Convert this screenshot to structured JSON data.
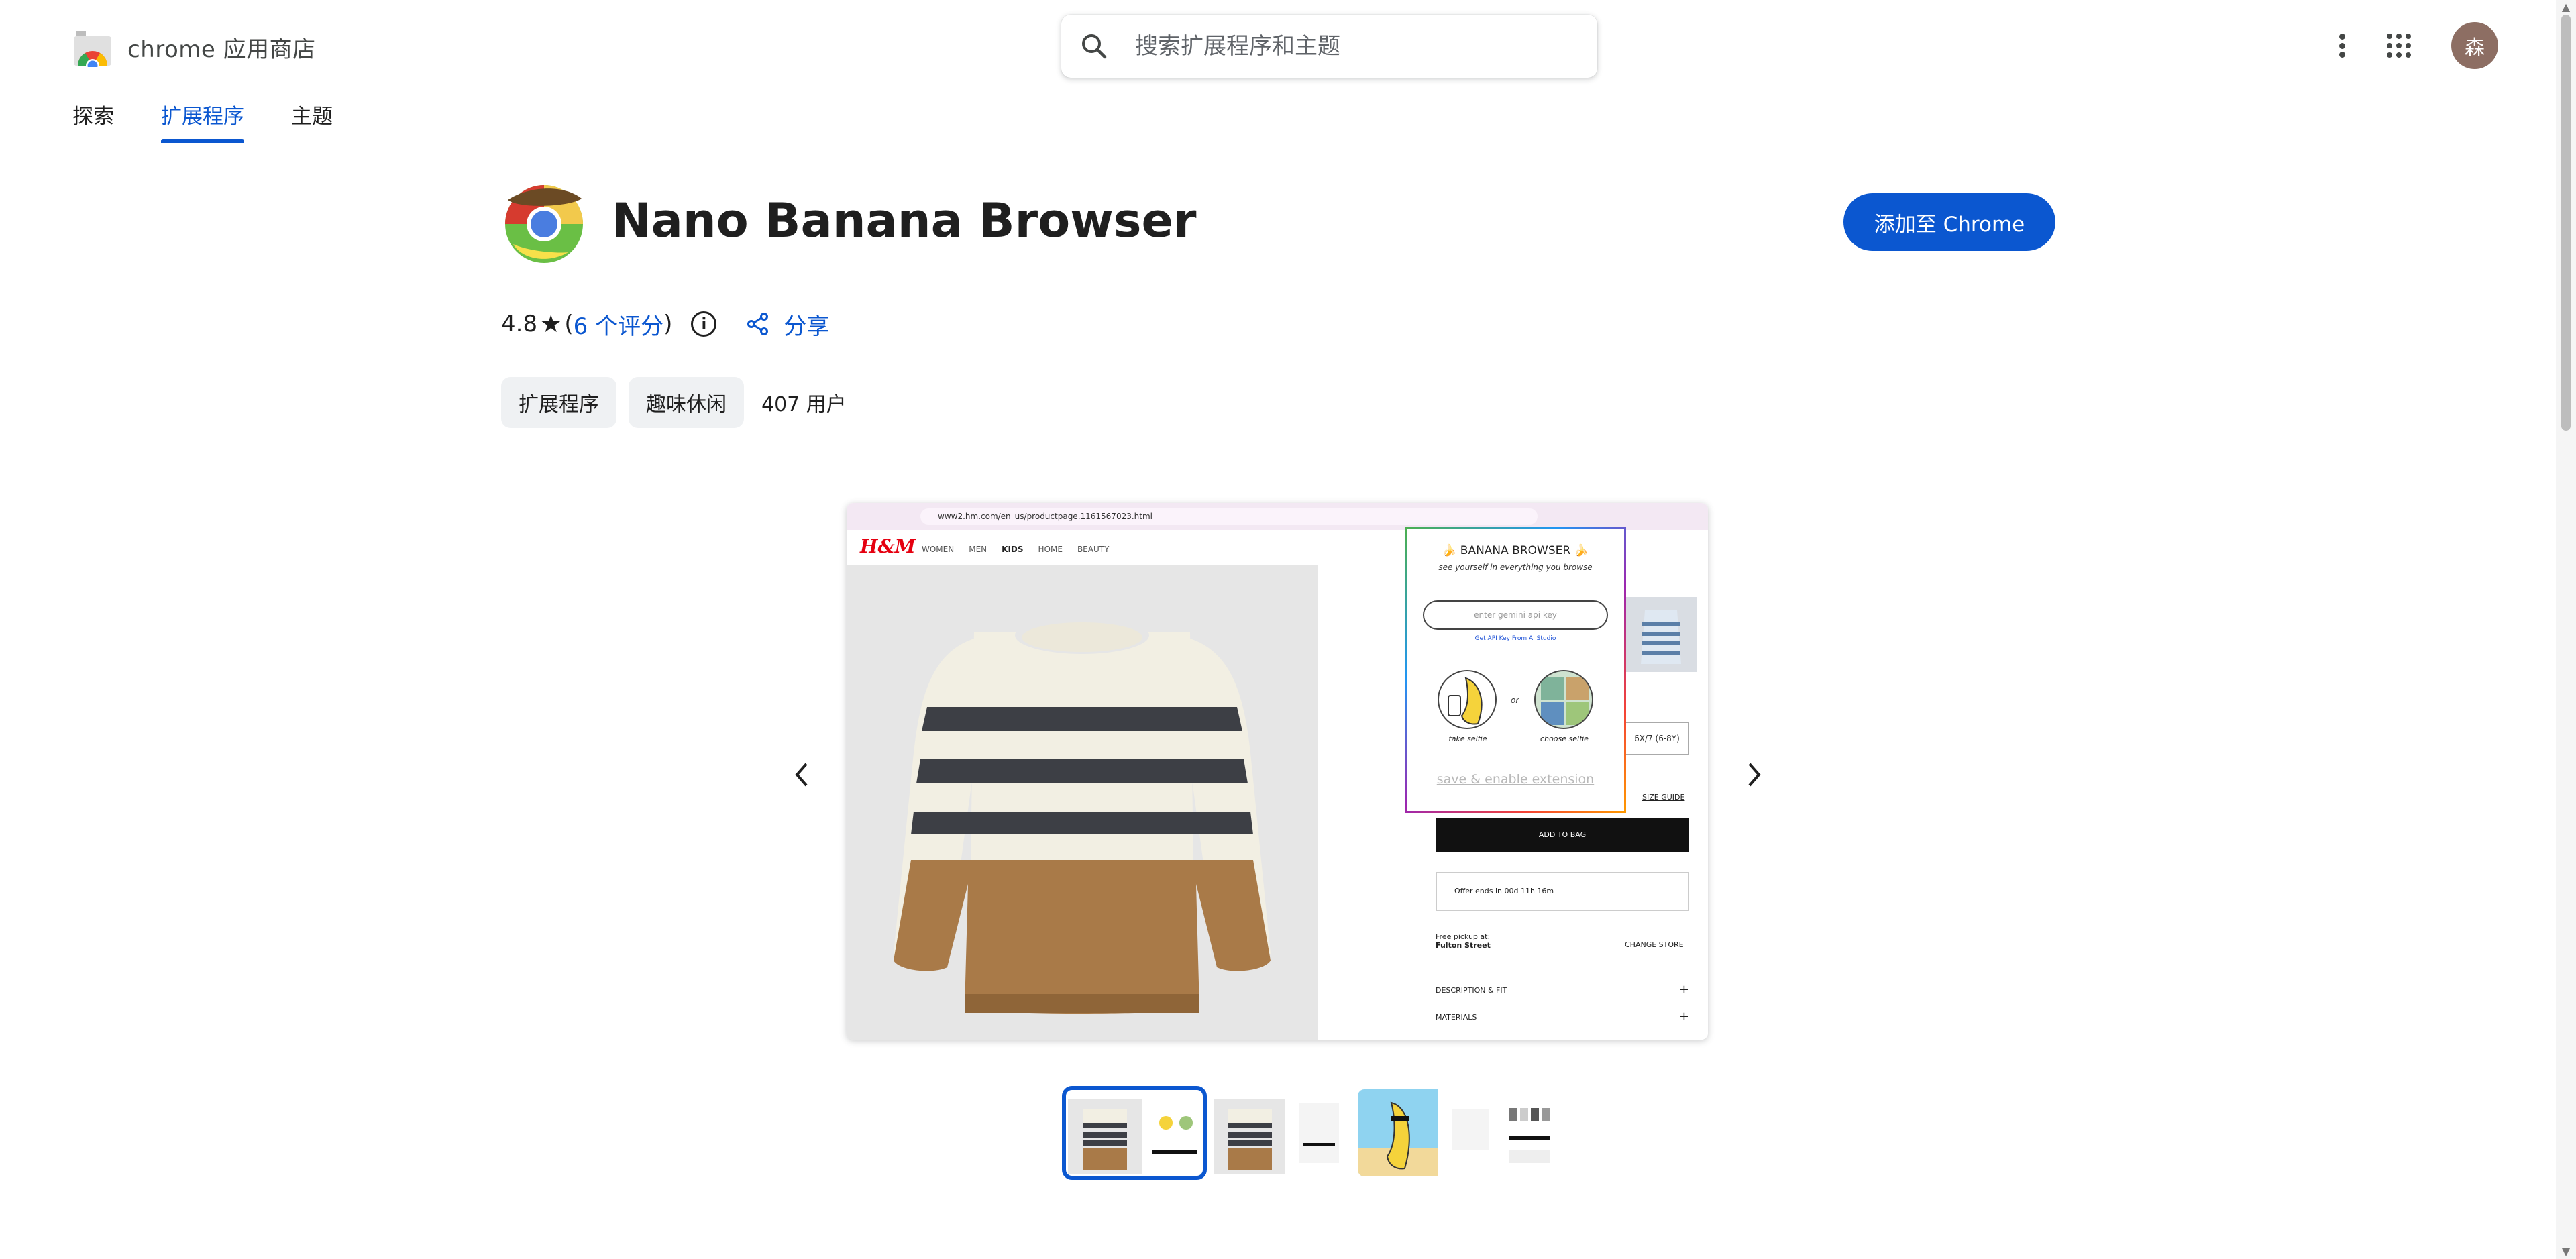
{
  "store": {
    "title": "chrome 应用商店"
  },
  "search": {
    "placeholder": "搜索扩展程序和主题"
  },
  "header": {
    "avatar_initial": "森"
  },
  "nav": {
    "tabs": [
      {
        "label": "探索"
      },
      {
        "label": "扩展程序",
        "active": true
      },
      {
        "label": "主题"
      }
    ]
  },
  "extension": {
    "name": "Nano Banana Browser",
    "add_button": "添加至 Chrome",
    "rating": "4.8",
    "star": "★",
    "ratings_open": "(",
    "ratings_link": "6 个评分",
    "ratings_close": ")",
    "share_label": "分享",
    "chips": [
      {
        "label": "扩展程序"
      },
      {
        "label": "趣味休闲"
      }
    ],
    "users": "407 用户"
  },
  "screenshot": {
    "url": "www2.hm.com/en_us/productpage.1161567023.html",
    "site_logo": "H&M",
    "site_nav": [
      "WOMEN",
      "MEN",
      "KIDS",
      "HOME",
      "BEAUTY"
    ],
    "popup": {
      "title": "🍌 BANANA BROWSER 🍌",
      "subtitle": "see yourself in everything you browse",
      "input_placeholder": "enter gemini api key",
      "api_link": "Get API Key From AI Studio",
      "take_selfie": "take selfie",
      "or": "or",
      "choose_selfie": "choose selfie",
      "save": "save & enable extension"
    },
    "size": "6X/7 (6-8Y)",
    "size_guide": "SIZE GUIDE",
    "add_to_bag": "ADD TO BAG",
    "offer": "Offer ends in  00d 11h 16m",
    "pickup_line1": "Free pickup at:",
    "pickup_line2": "Fulton Street",
    "change_store": "CHANGE STORE",
    "description": "DESCRIPTION & FIT",
    "materials": "MATERIALS"
  },
  "colors": {
    "accent": "#0b57d0",
    "chip_bg": "#eff1f3",
    "avatar": "#8d6e63"
  }
}
